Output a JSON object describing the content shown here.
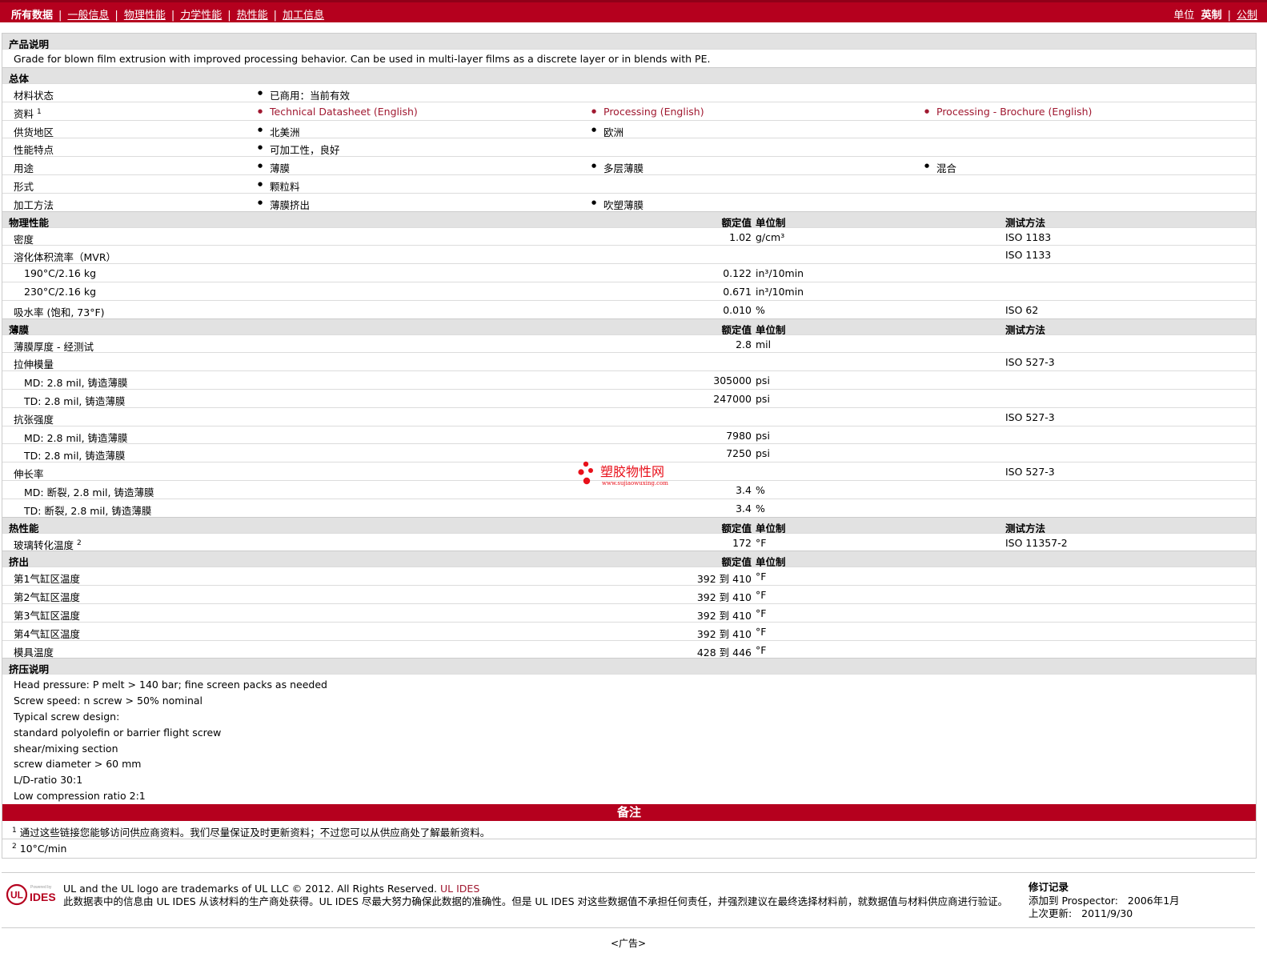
{
  "nav": {
    "items": [
      "所有数据",
      "一般信息",
      "物理性能",
      "力学性能",
      "热性能",
      "加工信息"
    ],
    "units_label": "单位",
    "unit_imperial": "英制",
    "unit_metric": "公制"
  },
  "description": {
    "title": "产品说明",
    "text": "Grade for blown film extrusion with improved processing behavior. Can be used in multi-layer films as a discrete layer or in blends with PE."
  },
  "general": {
    "title": "总体",
    "rows": [
      {
        "label": "材料状态",
        "items": [
          "已商用：当前有效"
        ]
      },
      {
        "label": "资料",
        "sup": "1",
        "items": [
          "Technical Datasheet (English)",
          "Processing (English)",
          "Processing - Brochure (English)"
        ]
      },
      {
        "label": "供货地区",
        "items": [
          "北美洲",
          "欧洲"
        ]
      },
      {
        "label": "性能特点",
        "items": [
          "可加工性，良好"
        ]
      },
      {
        "label": "用途",
        "items": [
          "薄膜",
          "多层薄膜",
          "混合"
        ]
      },
      {
        "label": "形式",
        "items": [
          "颗粒料"
        ]
      },
      {
        "label": "加工方法",
        "items": [
          "薄膜挤出",
          "吹塑薄膜"
        ]
      }
    ]
  },
  "col_headers": {
    "value": "额定值",
    "unit": "单位制",
    "method": "测试方法"
  },
  "physical": {
    "title": "物理性能",
    "rows": [
      {
        "label": "密度",
        "value": "1.02",
        "unit": "g/cm³",
        "method": "ISO 1183"
      },
      {
        "label": "溶化体积流率（MVR）",
        "value": "",
        "unit": "",
        "method": "ISO 1133"
      },
      {
        "label": "190°C/2.16 kg",
        "sub": true,
        "value": "0.122",
        "unit": "in³/10min",
        "method": ""
      },
      {
        "label": "230°C/2.16 kg",
        "sub": true,
        "value": "0.671",
        "unit": "in³/10min",
        "method": ""
      },
      {
        "label": "吸水率 (饱和, 73°F)",
        "value": "0.010",
        "unit": "%",
        "method": "ISO 62"
      }
    ]
  },
  "film": {
    "title": "薄膜",
    "rows": [
      {
        "label": "薄膜厚度  - 经测试",
        "value": "2.8",
        "unit": "mil",
        "method": ""
      },
      {
        "label": "拉伸模量",
        "value": "",
        "unit": "",
        "method": "ISO 527-3"
      },
      {
        "label": "MD: 2.8 mil, 铸造薄膜",
        "sub": true,
        "value": "305000",
        "unit": "psi",
        "method": ""
      },
      {
        "label": "TD: 2.8 mil, 铸造薄膜",
        "sub": true,
        "value": "247000",
        "unit": "psi",
        "method": ""
      },
      {
        "label": "抗张强度",
        "value": "",
        "unit": "",
        "method": "ISO 527-3"
      },
      {
        "label": "MD: 2.8 mil, 铸造薄膜",
        "sub": true,
        "value": "7980",
        "unit": "psi",
        "method": ""
      },
      {
        "label": "TD: 2.8 mil, 铸造薄膜",
        "sub": true,
        "value": "7250",
        "unit": "psi",
        "method": ""
      },
      {
        "label": "伸长率",
        "value": "",
        "unit": "",
        "method": "ISO 527-3"
      },
      {
        "label": "MD: 断裂, 2.8 mil, 铸造薄膜",
        "sub": true,
        "value": "3.4",
        "unit": "%",
        "method": ""
      },
      {
        "label": "TD: 断裂, 2.8 mil, 铸造薄膜",
        "sub": true,
        "value": "3.4",
        "unit": "%",
        "method": ""
      }
    ]
  },
  "thermal": {
    "title": "热性能",
    "rows": [
      {
        "label": "玻璃转化温度",
        "sup": "2",
        "value": "172",
        "unit": "°F",
        "method": "ISO 11357-2"
      }
    ]
  },
  "extrusion": {
    "title": "挤出",
    "rows": [
      {
        "label": "第1气缸区温度",
        "value": "392 到  410",
        "unit": "°F",
        "method": ""
      },
      {
        "label": "第2气缸区温度",
        "value": "392 到  410",
        "unit": "°F",
        "method": ""
      },
      {
        "label": "第3气缸区温度",
        "value": "392 到  410",
        "unit": "°F",
        "method": ""
      },
      {
        "label": "第4气缸区温度",
        "value": "392 到  410",
        "unit": "°F",
        "method": ""
      },
      {
        "label": "模具温度",
        "value": "428 到  446",
        "unit": "°F",
        "method": ""
      }
    ]
  },
  "extrusion_notes": {
    "title": "挤压说明",
    "lines": [
      "Head pressure: P melt > 140 bar; fine screen packs as needed",
      "Screw speed: n screw > 50% nominal",
      "Typical screw design:",
      "standard polyolefin or barrier flight screw",
      "shear/mixing section",
      "screw diameter > 60 mm",
      "L/D-ratio 30:1",
      "Low compression ratio 2:1"
    ]
  },
  "remarks": {
    "title": "备注",
    "notes": [
      {
        "num": "1",
        "text": "通过这些链接您能够访问供应商资料。我们尽量保证及时更新资料；不过您可以从供应商处了解最新资料。"
      },
      {
        "num": "2",
        "text": "10°C/min"
      }
    ]
  },
  "footer": {
    "trademark": "UL and the UL logo are trademarks of UL LLC © 2012. All Rights Reserved.",
    "trademark_link": "UL IDES",
    "disclaimer": "此数据表中的信息由 UL IDES 从该材料的生产商处获得。UL IDES 尽最大努力确保此数据的准确性。但是 UL IDES 对这些数据值不承担任何责任，并强烈建议在最终选择材料前，就数据值与材料供应商进行验证。",
    "logo_small": "Powered by",
    "logo_text": "IDES",
    "revision_title": "修订记录",
    "added_label": "添加到 Prospector:",
    "added_value": "2006年1月",
    "updated_label": "上次更新:",
    "updated_value": "2011/9/30"
  },
  "ad": "<广告>",
  "watermark": {
    "name": "塑胶物性网",
    "url": "www.sujiaowuxing.com"
  },
  "colors": {
    "brand": "#b5001e",
    "header_bg": "#e2e2e2",
    "link": "#a01830"
  }
}
